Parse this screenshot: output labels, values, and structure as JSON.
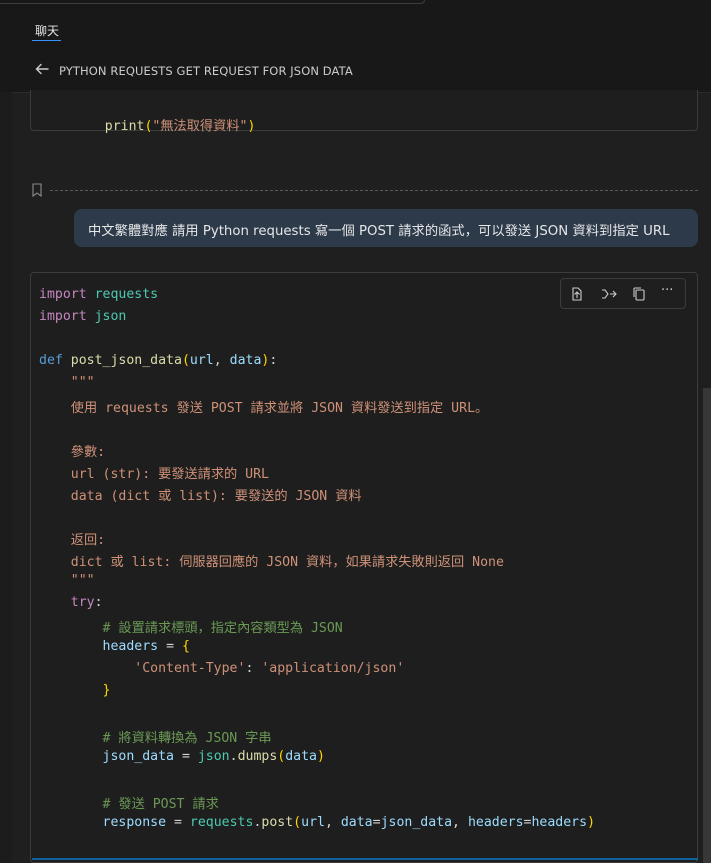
{
  "tab": {
    "label": "聊天"
  },
  "header": {
    "title": "PYTHON REQUESTS GET REQUEST FOR JSON DATA"
  },
  "prev_code": {
    "line": "print(\"無法取得資料\")"
  },
  "user_message": "中文繁體對應 請用 Python requests 寫一個 POST 請求的函式，可以發送 JSON 資料到指定 URL",
  "code_lines": [
    "import requests",
    "import json",
    "",
    "def post_json_data(url, data):",
    "    \"\"\"",
    "    使用 requests 發送 POST 請求並將 JSON 資料發送到指定 URL。",
    "",
    "    參數:",
    "    url (str): 要發送請求的 URL",
    "    data (dict 或 list): 要發送的 JSON 資料",
    "",
    "    返回:",
    "    dict 或 list: 伺服器回應的 JSON 資料，如果請求失敗則返回 None",
    "    \"\"\"",
    "    try:",
    "        # 設置請求標頭，指定內容類型為 JSON",
    "        headers = {",
    "            'Content-Type': 'application/json'",
    "        }",
    "",
    "        # 將資料轉換為 JSON 字串",
    "        json_data = json.dumps(data)",
    "",
    "        # 發送 POST 請求",
    "        response = requests.post(url, data=json_data, headers=headers)"
  ],
  "toolbar": {
    "icons": [
      "insert-at-cursor-icon",
      "insert-into-new-file-icon",
      "copy-icon",
      "more-actions-icon"
    ],
    "more_label": "···"
  },
  "colors": {
    "keyword": "#c586c0",
    "def_keyword": "#569cd6",
    "function": "#dcdcaa",
    "module": "#4ec9b0",
    "variable": "#9cdcfe",
    "string": "#ce9178",
    "comment": "#6a9955",
    "bubble": "#2c3a4a",
    "background": "#1f1f1f"
  }
}
